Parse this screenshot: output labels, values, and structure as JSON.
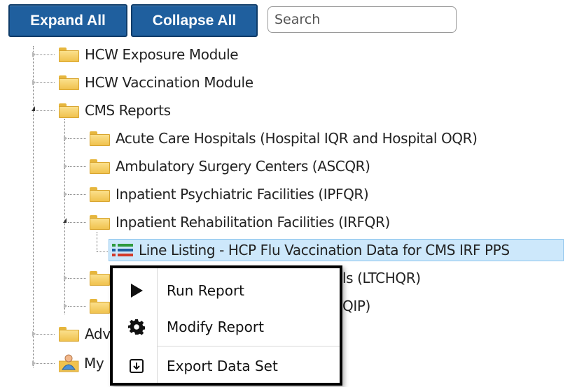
{
  "toolbar": {
    "expand_label": "Expand All",
    "collapse_label": "Collapse All",
    "search_placeholder": "Search"
  },
  "tree": {
    "top_items": [
      {
        "label": "HCW Exposure Module"
      },
      {
        "label": "HCW Vaccination Module"
      },
      {
        "label": "CMS Reports"
      }
    ],
    "cms_children": [
      {
        "label": "Acute Care Hospitals (Hospital IQR and Hospital OQR)"
      },
      {
        "label": "Ambulatory Surgery Centers (ASCQR)"
      },
      {
        "label": "Inpatient Psychiatric Facilities (IPFQR)"
      },
      {
        "label": "Inpatient Rehabilitation Facilities (IRFQR)"
      }
    ],
    "selected_report": "Line Listing - HCP Flu Vaccination Data for CMS IRF PPS",
    "partially_hidden": [
      {
        "label": "ls (LTCHQR)"
      },
      {
        "label": "QIP)"
      },
      {
        "label": "Adv"
      },
      {
        "label": "My"
      }
    ]
  },
  "context_menu": {
    "items": [
      {
        "label": "Run Report",
        "icon": "play-icon"
      },
      {
        "label": "Modify Report",
        "icon": "gear-icon"
      },
      {
        "label": "Export Data Set",
        "icon": "export-icon"
      }
    ]
  },
  "colors": {
    "button_bg": "#1f5f9e",
    "selection_bg": "#cde8fb",
    "folder_yellow": "#f0c24e"
  }
}
